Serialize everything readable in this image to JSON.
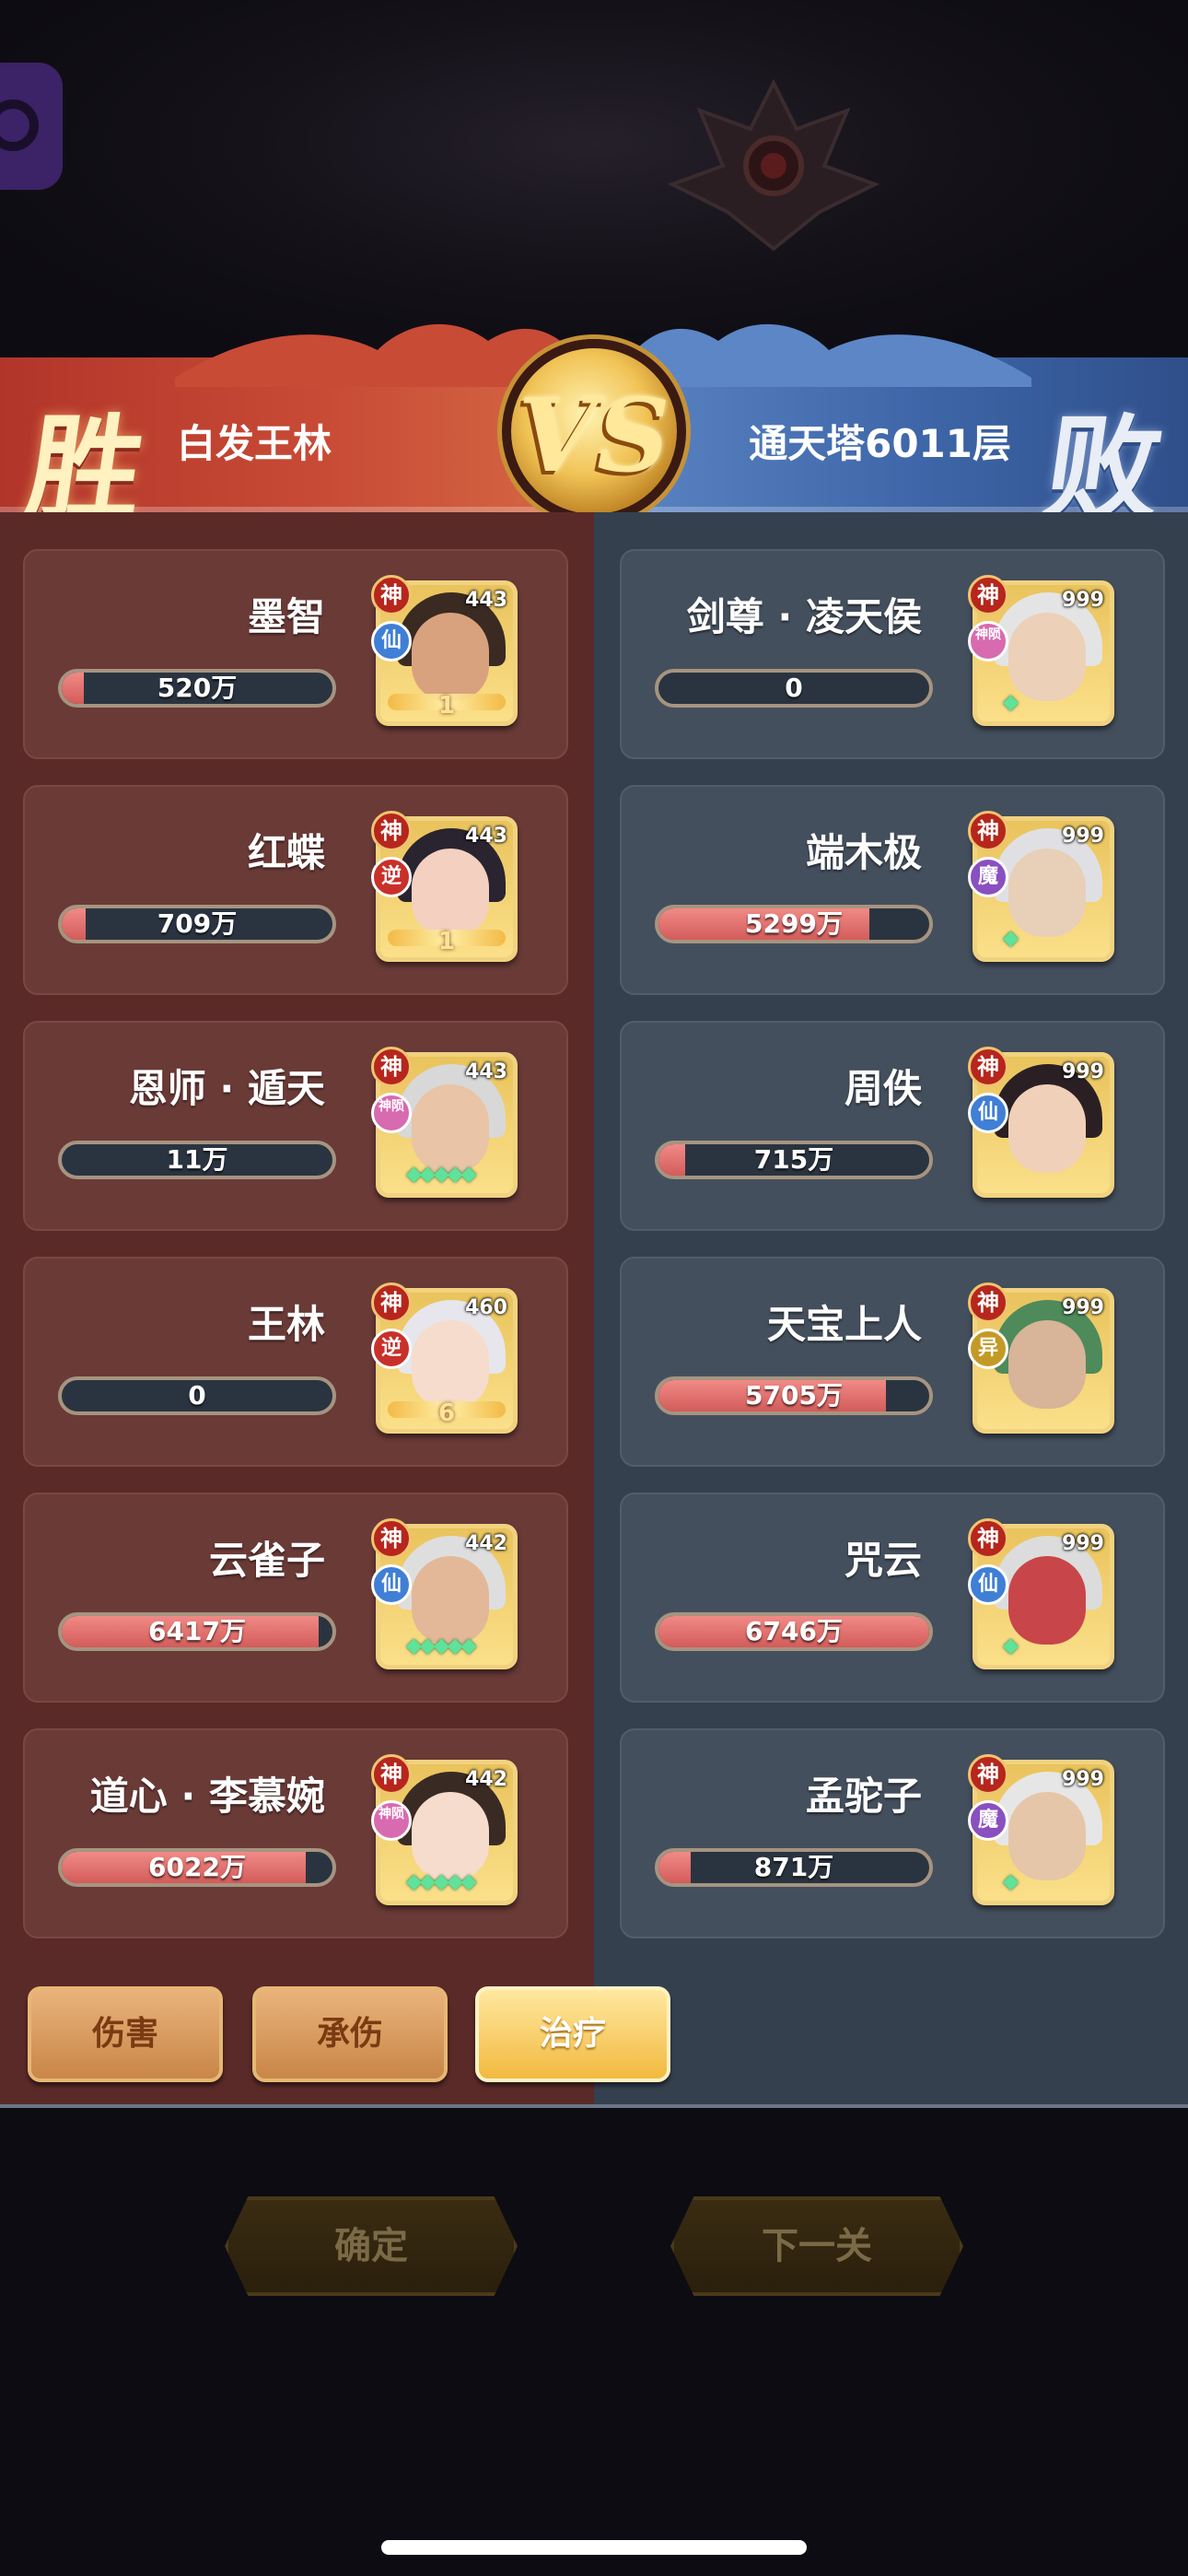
{
  "header": {
    "left_result": "胜",
    "left_player": "白发王林",
    "vs": "VS",
    "right_player": "通天塔6011层",
    "right_result": "败"
  },
  "left_team": [
    {
      "name": "墨智",
      "stat": "520万",
      "fill": 0.08,
      "level": "443",
      "rank": "神",
      "type": "仙",
      "type_color": "#3f7fd6",
      "star": "1",
      "stars": "",
      "face": "#d9a27e",
      "hair": "#3a2a22"
    },
    {
      "name": "红蝶",
      "stat": "709万",
      "fill": 0.09,
      "level": "443",
      "rank": "神",
      "type": "逆",
      "type_color": "#c9302a",
      "star": "1",
      "stars": "",
      "face": "#f4d0c0",
      "hair": "#2a2430"
    },
    {
      "name": "恩师 · 遁天",
      "stat": "11万",
      "fill": 0.0,
      "level": "443",
      "rank": "神",
      "type": "神陨",
      "type_color": "#d86ab0",
      "star": "",
      "stars": "◆◆◆◆◆",
      "face": "#e9c4a6",
      "hair": "#d8d8d8"
    },
    {
      "name": "王林",
      "stat": "0",
      "fill": 0.0,
      "level": "460",
      "rank": "神",
      "type": "逆",
      "type_color": "#c9302a",
      "star": "6",
      "stars": "",
      "face": "#f6dccc",
      "hair": "#e6e6ec"
    },
    {
      "name": "云雀子",
      "stat": "6417万",
      "fill": 0.95,
      "level": "442",
      "rank": "神",
      "type": "仙",
      "type_color": "#3f7fd6",
      "star": "",
      "stars": "◆◆◆◆◆",
      "face": "#e2b898",
      "hair": "#dedede"
    },
    {
      "name": "道心 · 李慕婉",
      "stat": "6022万",
      "fill": 0.9,
      "level": "442",
      "rank": "神",
      "type": "神陨",
      "type_color": "#d86ab0",
      "star": "",
      "stars": "◆◆◆◆◆",
      "face": "#f6dccc",
      "hair": "#3a2a24"
    }
  ],
  "right_team": [
    {
      "name": "剑尊 · 凌天侯",
      "stat": "0",
      "fill": 0.0,
      "level": "999",
      "rank": "神",
      "type": "神陨",
      "type_color": "#d86ab0",
      "star": "",
      "stars": "◆",
      "face": "#ecd0b8",
      "hair": "#e4e4e4"
    },
    {
      "name": "端木极",
      "stat": "5299万",
      "fill": 0.78,
      "level": "999",
      "rank": "神",
      "type": "魔",
      "type_color": "#8a4fc0",
      "star": "",
      "stars": "◆",
      "face": "#e8cfb8",
      "hair": "#e0e0e4"
    },
    {
      "name": "周佚",
      "stat": "715万",
      "fill": 0.1,
      "level": "999",
      "rank": "神",
      "type": "仙",
      "type_color": "#3f7fd6",
      "star": "",
      "stars": "",
      "face": "#f0d0b8",
      "hair": "#2a2024"
    },
    {
      "name": "天宝上人",
      "stat": "5705万",
      "fill": 0.84,
      "level": "999",
      "rank": "神",
      "type": "异",
      "type_color": "#c49a26",
      "star": "",
      "stars": "",
      "face": "#d8b498",
      "hair": "#4e8a5a"
    },
    {
      "name": "咒云",
      "stat": "6746万",
      "fill": 1.0,
      "level": "999",
      "rank": "神",
      "type": "仙",
      "type_color": "#3f7fd6",
      "star": "",
      "stars": "◆",
      "face": "#c8464a",
      "hair": "#dcdcdc"
    },
    {
      "name": "孟驼子",
      "stat": "871万",
      "fill": 0.12,
      "level": "999",
      "rank": "神",
      "type": "魔",
      "type_color": "#8a4fc0",
      "star": "",
      "stars": "◆",
      "face": "#e6c6a8",
      "hair": "#e6e6e6"
    }
  ],
  "tabs": [
    {
      "label": "伤害",
      "active": false
    },
    {
      "label": "承伤",
      "active": false
    },
    {
      "label": "治疗",
      "active": true
    }
  ],
  "buttons": {
    "confirm": "确定",
    "next": "下一关"
  }
}
